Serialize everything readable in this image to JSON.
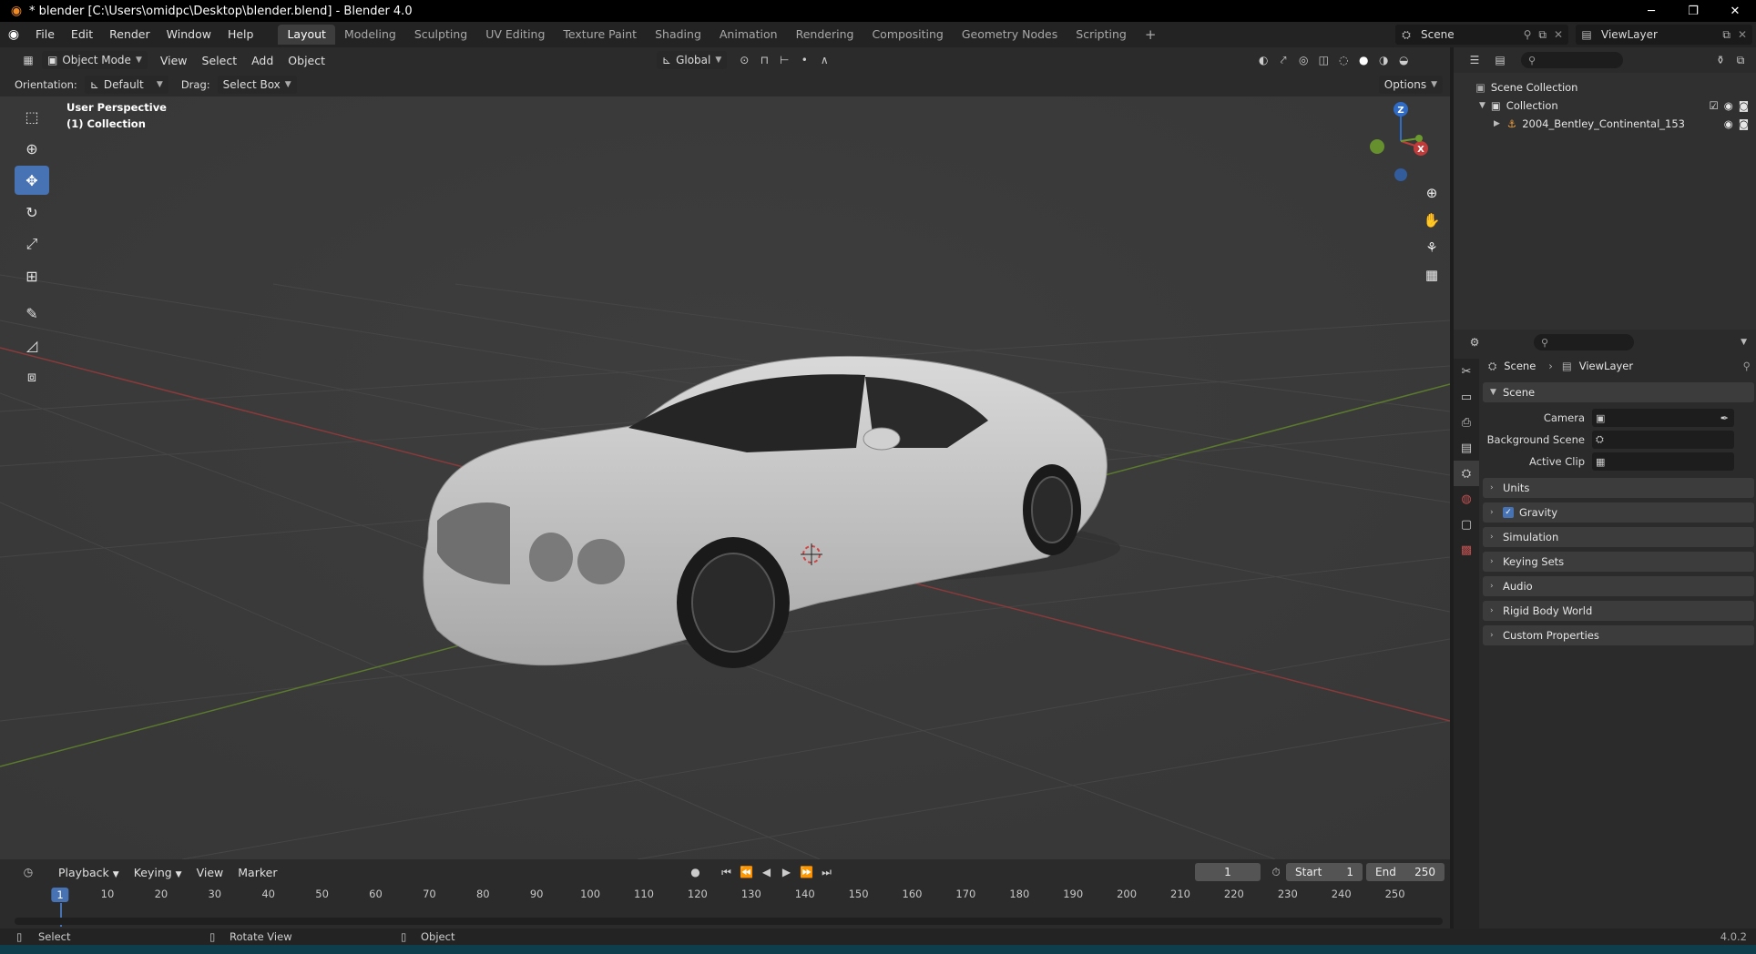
{
  "window": {
    "title": "* blender [C:\\Users\\omidpc\\Desktop\\blender.blend] - Blender 4.0",
    "controls": [
      "minimize-icon",
      "restore-icon",
      "close-icon"
    ]
  },
  "menus": [
    "File",
    "Edit",
    "Render",
    "Window",
    "Help"
  ],
  "workspaces": [
    "Layout",
    "Modeling",
    "Sculpting",
    "UV Editing",
    "Texture Paint",
    "Shading",
    "Animation",
    "Rendering",
    "Compositing",
    "Geometry Nodes",
    "Scripting"
  ],
  "active_workspace": "Layout",
  "scene_selector": {
    "value": "Scene"
  },
  "viewlayer_selector": {
    "value": "ViewLayer"
  },
  "viewport": {
    "mode": "Object Mode",
    "header_menus": [
      "View",
      "Select",
      "Add",
      "Object"
    ],
    "transform_orientation": "Global",
    "orientation_label": "Orientation:",
    "orientation_value": "Default",
    "drag_label": "Drag:",
    "drag_value": "Select Box",
    "options_label": "Options",
    "overlay_line1": "User Perspective",
    "overlay_line2": "(1) Collection",
    "gizmo_labels": {
      "z": "Z",
      "x": "X"
    }
  },
  "tools": [
    "select-box-icon",
    "cursor-icon",
    "move-icon",
    "rotate-icon",
    "scale-icon",
    "transform-icon",
    "annotate-icon",
    "measure-icon",
    "add-cube-icon"
  ],
  "active_tool": "move-icon",
  "timeline": {
    "menus": [
      "Playback",
      "Keying",
      "View",
      "Marker"
    ],
    "current_frame": "1",
    "start_label": "Start",
    "start_value": "1",
    "end_label": "End",
    "end_value": "250",
    "ruler": [
      "1",
      "10",
      "20",
      "30",
      "40",
      "50",
      "60",
      "70",
      "80",
      "90",
      "100",
      "110",
      "120",
      "130",
      "140",
      "150",
      "160",
      "170",
      "180",
      "190",
      "200",
      "210",
      "220",
      "230",
      "240",
      "250"
    ]
  },
  "statusbar": {
    "select": "Select",
    "rotate": "Rotate View",
    "object": "Object",
    "version": "4.0.2"
  },
  "outliner": {
    "rows": [
      {
        "label": "Scene Collection",
        "icon": "scene-collection-icon"
      },
      {
        "label": "Collection",
        "icon": "collection-icon"
      },
      {
        "label": "2004_Bentley_Continental_153",
        "icon": "armature-icon"
      }
    ]
  },
  "properties": {
    "breadcrumb": [
      "Scene",
      "ViewLayer"
    ],
    "panel_title": "Scene",
    "fields": [
      {
        "label": "Camera",
        "value": ""
      },
      {
        "label": "Background Scene",
        "value": ""
      },
      {
        "label": "Active Clip",
        "value": ""
      }
    ],
    "sections": [
      "Units",
      "Gravity",
      "Simulation",
      "Keying Sets",
      "Audio",
      "Rigid Body World",
      "Custom Properties"
    ],
    "gravity_checked": true
  },
  "colors": {
    "accent": "#4772b3",
    "x_axis": "#c13b3b",
    "y_axis": "#6b9a2e",
    "z_axis": "#2f6cc7",
    "car_body": "#cfcfcf"
  }
}
